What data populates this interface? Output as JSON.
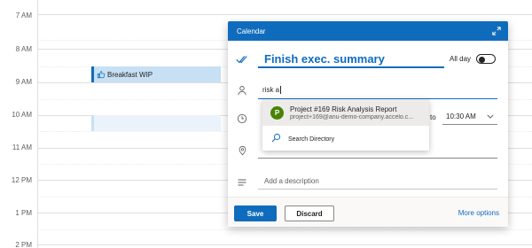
{
  "calendar": {
    "time_labels": [
      "7 AM",
      "8 AM",
      "9 AM",
      "10 AM",
      "11 AM",
      "12 PM",
      "1 PM",
      "2 PM"
    ],
    "events": {
      "breakfast": {
        "title": "Breakfast WIP",
        "icon": "thumbs-up-icon"
      }
    }
  },
  "popup": {
    "header_title": "Calendar",
    "title_value": "Finish exec. summary",
    "all_day_label": "All day",
    "all_day_on": false,
    "attendee_value": "risk a",
    "to_label": "to",
    "end_time": "10:30 AM",
    "description_placeholder": "Add a description",
    "save_label": "Save",
    "discard_label": "Discard",
    "more_options_label": "More options"
  },
  "suggestions": {
    "items": [
      {
        "initial": "P",
        "name": "Project #169 Risk Analysis Report",
        "email": "project+169@anu-demo-company.accelo.c..."
      }
    ],
    "search_directory_label": "Search Directory"
  },
  "colors": {
    "accent": "#0f6cbd",
    "event_fill": "#c7e0f4",
    "avatar": "#498205"
  }
}
